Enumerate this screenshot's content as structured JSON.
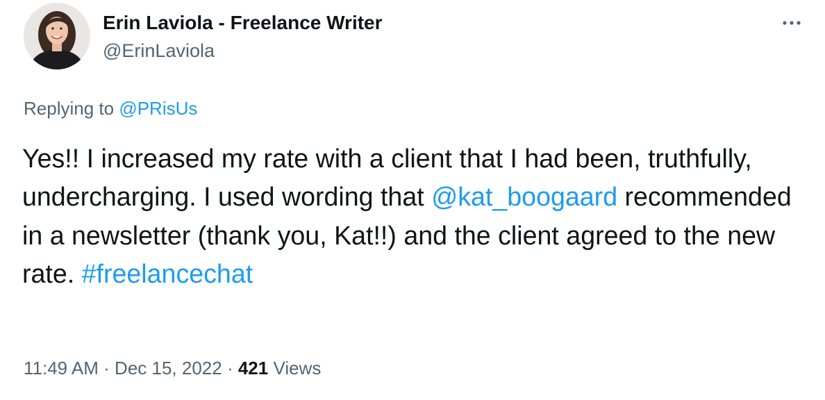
{
  "author": {
    "display_name": "Erin Laviola - Freelance Writer",
    "handle": "@ErinLaviola",
    "avatar_icon": "profile-photo"
  },
  "menu": {
    "more_icon": "more-horizontal-icon"
  },
  "reply": {
    "prefix": "Replying to ",
    "mention": "@PRisUs"
  },
  "tweet": {
    "text_1": "Yes!! I increased my rate with a client that I had been, truthfully, undercharging. I used wording that ",
    "mention": "@kat_boogaard",
    "text_2": " recommended in a newsletter (thank you, Kat!!) and the client agreed to the new rate. ",
    "hashtag": "#freelancechat"
  },
  "meta": {
    "time": "11:49 AM",
    "separator": " · ",
    "date": "Dec 15, 2022",
    "views_count": "421",
    "views_label": " Views"
  },
  "colors": {
    "link": "#1d9bf0",
    "secondary_text": "#536471",
    "primary_text": "#0f1419"
  }
}
